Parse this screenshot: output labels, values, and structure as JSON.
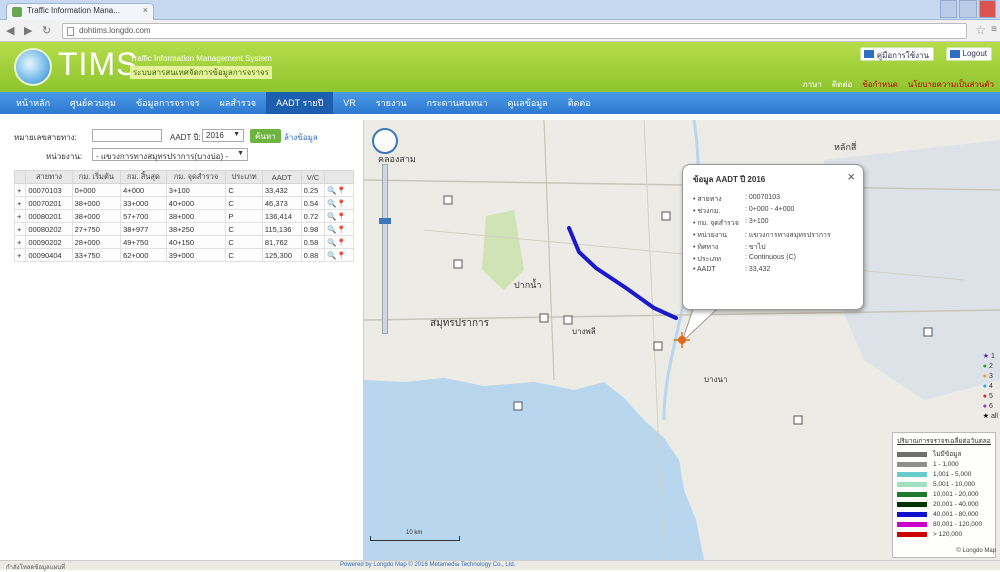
{
  "browser": {
    "tab_title": "Traffic Information Mana...",
    "url": "dohtims.longdo.com",
    "close_glyph": "×"
  },
  "header": {
    "logo_text": "TIMS",
    "subtitle_en": "Traffic Information Management System",
    "subtitle_th": "ระบบสารสนเทศจัดการข้อมูลการจราจร",
    "btn_manual": "คู่มือการใช้งาน",
    "btn_logout": "Logout",
    "links": [
      "ภาษา",
      "ติดต่อ",
      "ข้อกำหนด",
      "นโยบายความเป็นส่วนตัว"
    ]
  },
  "nav": {
    "items": [
      "หน้าหลัก",
      "ศูนย์ควบคุม",
      "ข้อมูลการจราจร",
      "ผลสำรวจ",
      "AADT รายปี",
      "VR",
      "รายงาน",
      "กระดานสนทนา",
      "ดูแลข้อมูล",
      "ติดต่อ"
    ],
    "active": "AADT รายปี"
  },
  "form": {
    "label_route": "หมายเลขสายทาง:",
    "route_value": "",
    "label_aadt": "AADT ปี:",
    "aadt_year": "2016",
    "search_btn": "ค้นหา",
    "clear_link": "ล้างข้อมูล",
    "label_district": "หน่วยงาน:",
    "district_value": "- แขวงการทางสมุทรปราการ(บางบ่อ) -"
  },
  "table": {
    "headers": [
      "",
      "สายทาง",
      "กม. เริ่มต้น",
      "กม. สิ้นสุด",
      "กม. จุดสำรวจ",
      "ประเภท",
      "AADT",
      "V/C",
      ""
    ],
    "rows": [
      [
        "+",
        "00070103",
        "0+000",
        "4+000",
        "3+100",
        "C",
        "33,432",
        "0.25"
      ],
      [
        "+",
        "00070201",
        "38+000",
        "33+000",
        "40+000",
        "C",
        "46,373",
        "0.54"
      ],
      [
        "+",
        "00080201",
        "38+000",
        "57+700",
        "38+000",
        "P",
        "136,414",
        "0.72"
      ],
      [
        "+",
        "00080202",
        "27+750",
        "38+977",
        "38+250",
        "C",
        "115,136",
        "0.98"
      ],
      [
        "+",
        "00090202",
        "28+000",
        "49+750",
        "40+150",
        "C",
        "81,762",
        "0.58"
      ],
      [
        "+",
        "00090404",
        "33+750",
        "62+000",
        "39+000",
        "C",
        "125,300",
        "0.88"
      ]
    ]
  },
  "map": {
    "labels": [
      "คลองสาม",
      "หลักสี่",
      "ปากน้ำ",
      "บางพลี",
      "สมุทรปราการ",
      "บางนา"
    ],
    "scale": "10 km",
    "attribution": "© Longdo Map",
    "marker_legend": [
      "1",
      "2",
      "3",
      "4",
      "5",
      "6",
      "all"
    ]
  },
  "popup": {
    "title": "ข้อมูล AADT ปี 2016",
    "rows": [
      {
        "k": "สายทาง",
        "v": ": 00070103"
      },
      {
        "k": "ช่วงกม.",
        "v": ": 0+000 - 4+000"
      },
      {
        "k": "กม. จุดสำรวจ",
        "v": ": 3+100"
      },
      {
        "k": "หน่วยงาน",
        "v": ": แขวงการทางสมุทรปราการ"
      },
      {
        "k": "ทิศทาง",
        "v": ": ขาไป"
      },
      {
        "k": "ประเภท",
        "v": ": Continuous (C)"
      },
      {
        "k": "AADT",
        "v": ": 33,432"
      }
    ]
  },
  "legend": {
    "title": "ปริมาณการจราจรเฉลี่ยต่อวันตลอดปี (คันต่อวัน)",
    "items": [
      {
        "color": "#6f6f6f",
        "label": "ไม่มีข้อมูล"
      },
      {
        "color": "#8f8f8f",
        "label": "1 - 1,000"
      },
      {
        "color": "#66cccc",
        "label": "1,001 - 5,000"
      },
      {
        "color": "#9fe0c0",
        "label": "5,001 - 10,000"
      },
      {
        "color": "#1f7a2e",
        "label": "10,001 - 20,000"
      },
      {
        "color": "#003300",
        "label": "20,001 - 40,000"
      },
      {
        "color": "#1010cc",
        "label": "40,001 - 80,000"
      },
      {
        "color": "#cc00cc",
        "label": "80,001 - 120,000"
      },
      {
        "color": "#cc0000",
        "label": "> 120,000"
      }
    ]
  },
  "status": {
    "left": "กำลังโหลดข้อมูลแผนที่",
    "right": "Powered by Longdo Map © 2016 Metamedia Technology Co., Ltd."
  },
  "colors": {
    "header_green": "#8ec530",
    "nav_blue": "#2c78cf",
    "route_line": "#1a1acc",
    "marker": "#e06a1b"
  }
}
